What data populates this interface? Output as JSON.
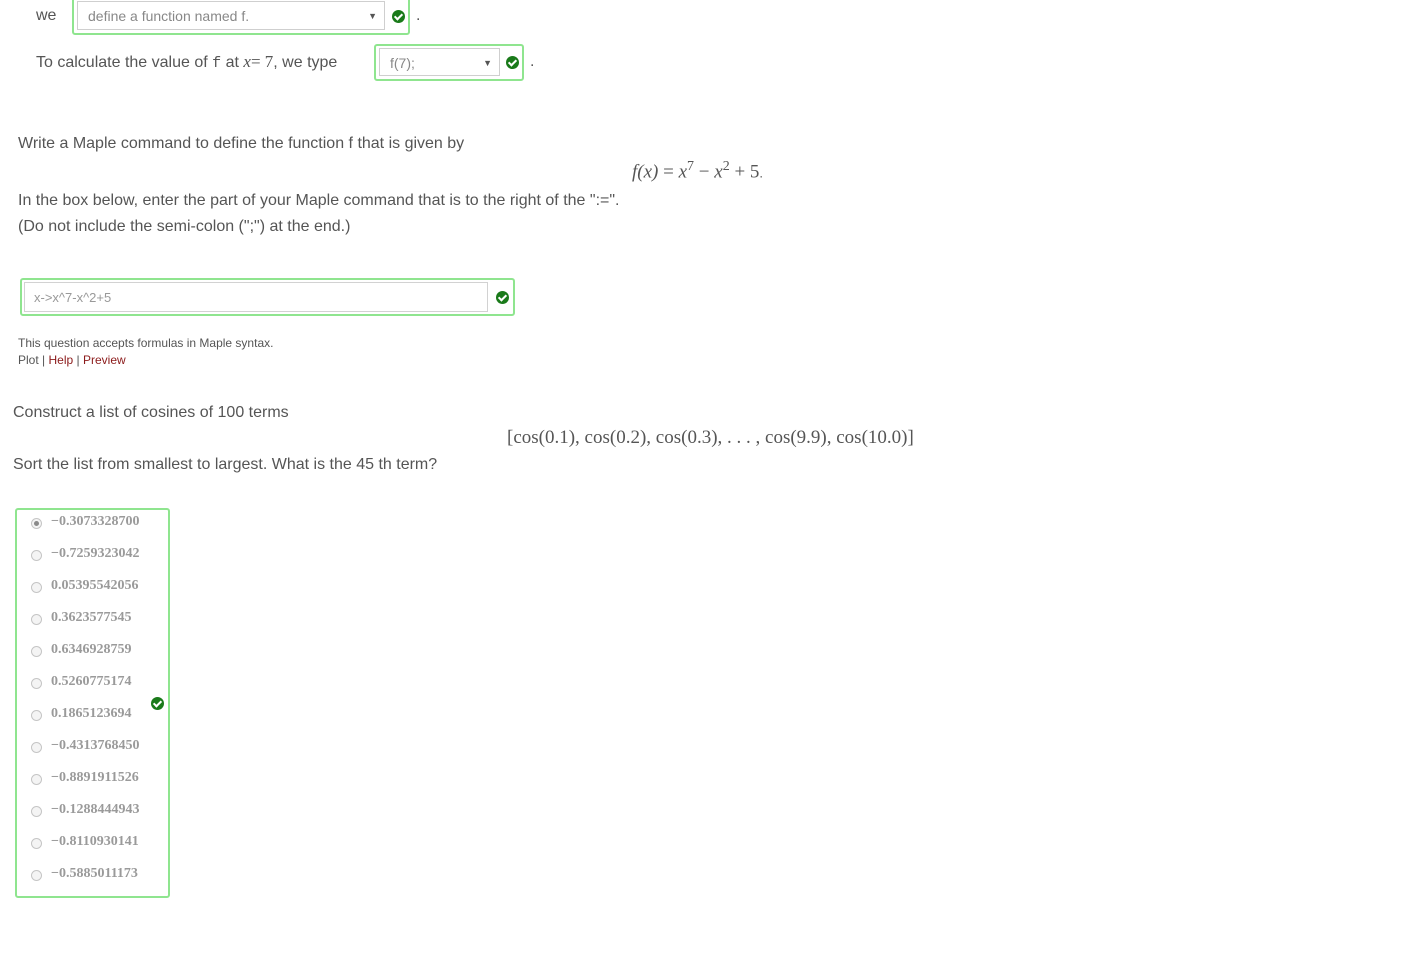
{
  "q1": {
    "prefix": "we",
    "select1_value": "define a function named f.",
    "after1": ".",
    "line2_text_a": "To calculate the value of",
    "line2_code": "f",
    "line2_text_b": "at",
    "line2_math_x": "x",
    "line2_math_eq": "= 7",
    "line2_text_c": ", we type",
    "select2_value": "f(7);",
    "after2": "."
  },
  "q2": {
    "prompt": "Write a Maple command to define the function f that is given by",
    "formula": {
      "lhs": "f",
      "lhs_paren": "(x)",
      "eq": " = ",
      "x1": "x",
      "exp1": "7",
      "minus": " − ",
      "x2": "x",
      "exp2": "2",
      "plus": " + 5",
      "end": "."
    },
    "instruction_1": "In the box below, enter the part of your Maple command that is to the right of the \":=\".",
    "instruction_2": "(Do not include the semi-colon (\";\") at the end.)",
    "answer_value": "x->x^7-x^2+5",
    "syntax_note": "This question accepts formulas in Maple syntax.",
    "links": {
      "plot": "Plot",
      "sep1": "|",
      "help": "Help",
      "sep2": "|",
      "preview": "Preview"
    }
  },
  "q3": {
    "prompt": "Construct a list of cosines of 100 terms",
    "list_formula": "[cos(0.1), cos(0.2), cos(0.3), . . . , cos(9.9), cos(10.0)]",
    "question": "Sort the list from smallest to largest. What is the 45 th term?",
    "options": [
      "−0.3073328700",
      "−0.7259323042",
      "0.05395542056",
      "0.3623577545",
      "0.6346928759",
      "0.5260775174",
      "0.1865123694",
      "−0.4313768450",
      "−0.8891911526",
      "−0.1288444943",
      "−0.8110930141",
      "−0.5885011173"
    ],
    "selected_index": 0
  },
  "colors": {
    "correct_green": "#8fe58f",
    "check_green": "#1a7a1a",
    "link_red": "#8b1a1a",
    "text": "#555555"
  },
  "icons": {
    "check": "check-circle-icon",
    "caret": "caret-down-icon"
  }
}
